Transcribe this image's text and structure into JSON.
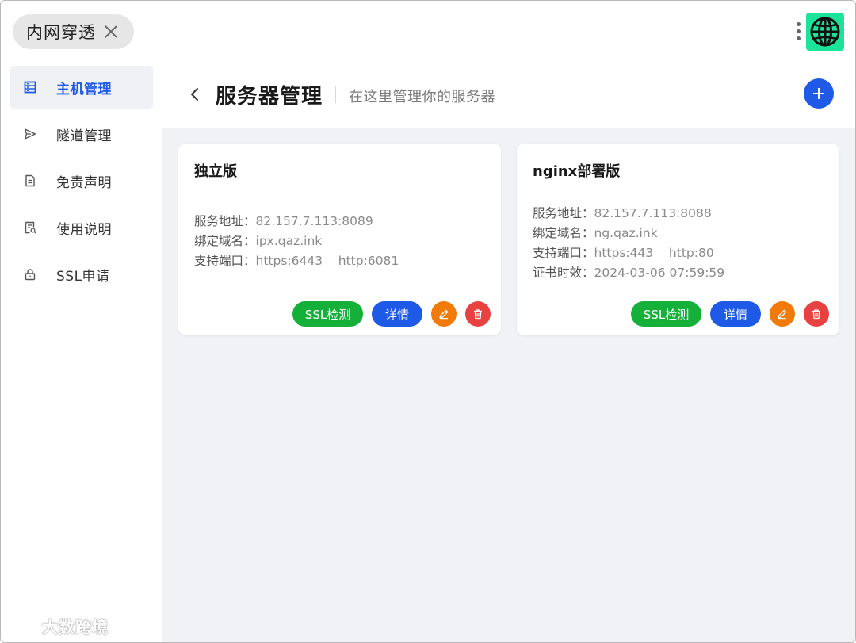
{
  "app": {
    "tab_title": "内网穿透"
  },
  "sidebar": {
    "items": [
      {
        "label": "主机管理",
        "icon": "server-list-icon",
        "active": true
      },
      {
        "label": "隧道管理",
        "icon": "send-icon",
        "active": false
      },
      {
        "label": "免责声明",
        "icon": "document-icon",
        "active": false
      },
      {
        "label": "使用说明",
        "icon": "guide-icon",
        "active": false
      },
      {
        "label": "SSL申请",
        "icon": "lock-icon",
        "active": false
      }
    ]
  },
  "header": {
    "title": "服务器管理",
    "subtitle": "在这里管理你的服务器"
  },
  "colors": {
    "primary": "#1f5ae6",
    "success": "#14b03a",
    "warning": "#f27a0a",
    "danger": "#e84141",
    "globe_bg": "#1ce39a"
  },
  "cards": [
    {
      "title": "独立版",
      "rows": [
        {
          "key": "服务地址：",
          "value": "82.157.7.113:8089"
        },
        {
          "key": "绑定域名：",
          "value": "ipx.qaz.ink"
        },
        {
          "key": "支持端口：",
          "value": "https:6443    http:6081"
        }
      ],
      "ssl_label": "SSL检测",
      "detail_label": "详情"
    },
    {
      "title": "nginx部署版",
      "rows": [
        {
          "key": "服务地址：",
          "value": "82.157.7.113:8088"
        },
        {
          "key": "绑定域名：",
          "value": "ng.qaz.ink"
        },
        {
          "key": "支持端口：",
          "value": "https:443    http:80"
        },
        {
          "key": "证书时效：",
          "value": "2024-03-06 07:59:59"
        }
      ],
      "ssl_label": "SSL检测",
      "detail_label": "详情"
    }
  ],
  "watermark": "大数跨境"
}
